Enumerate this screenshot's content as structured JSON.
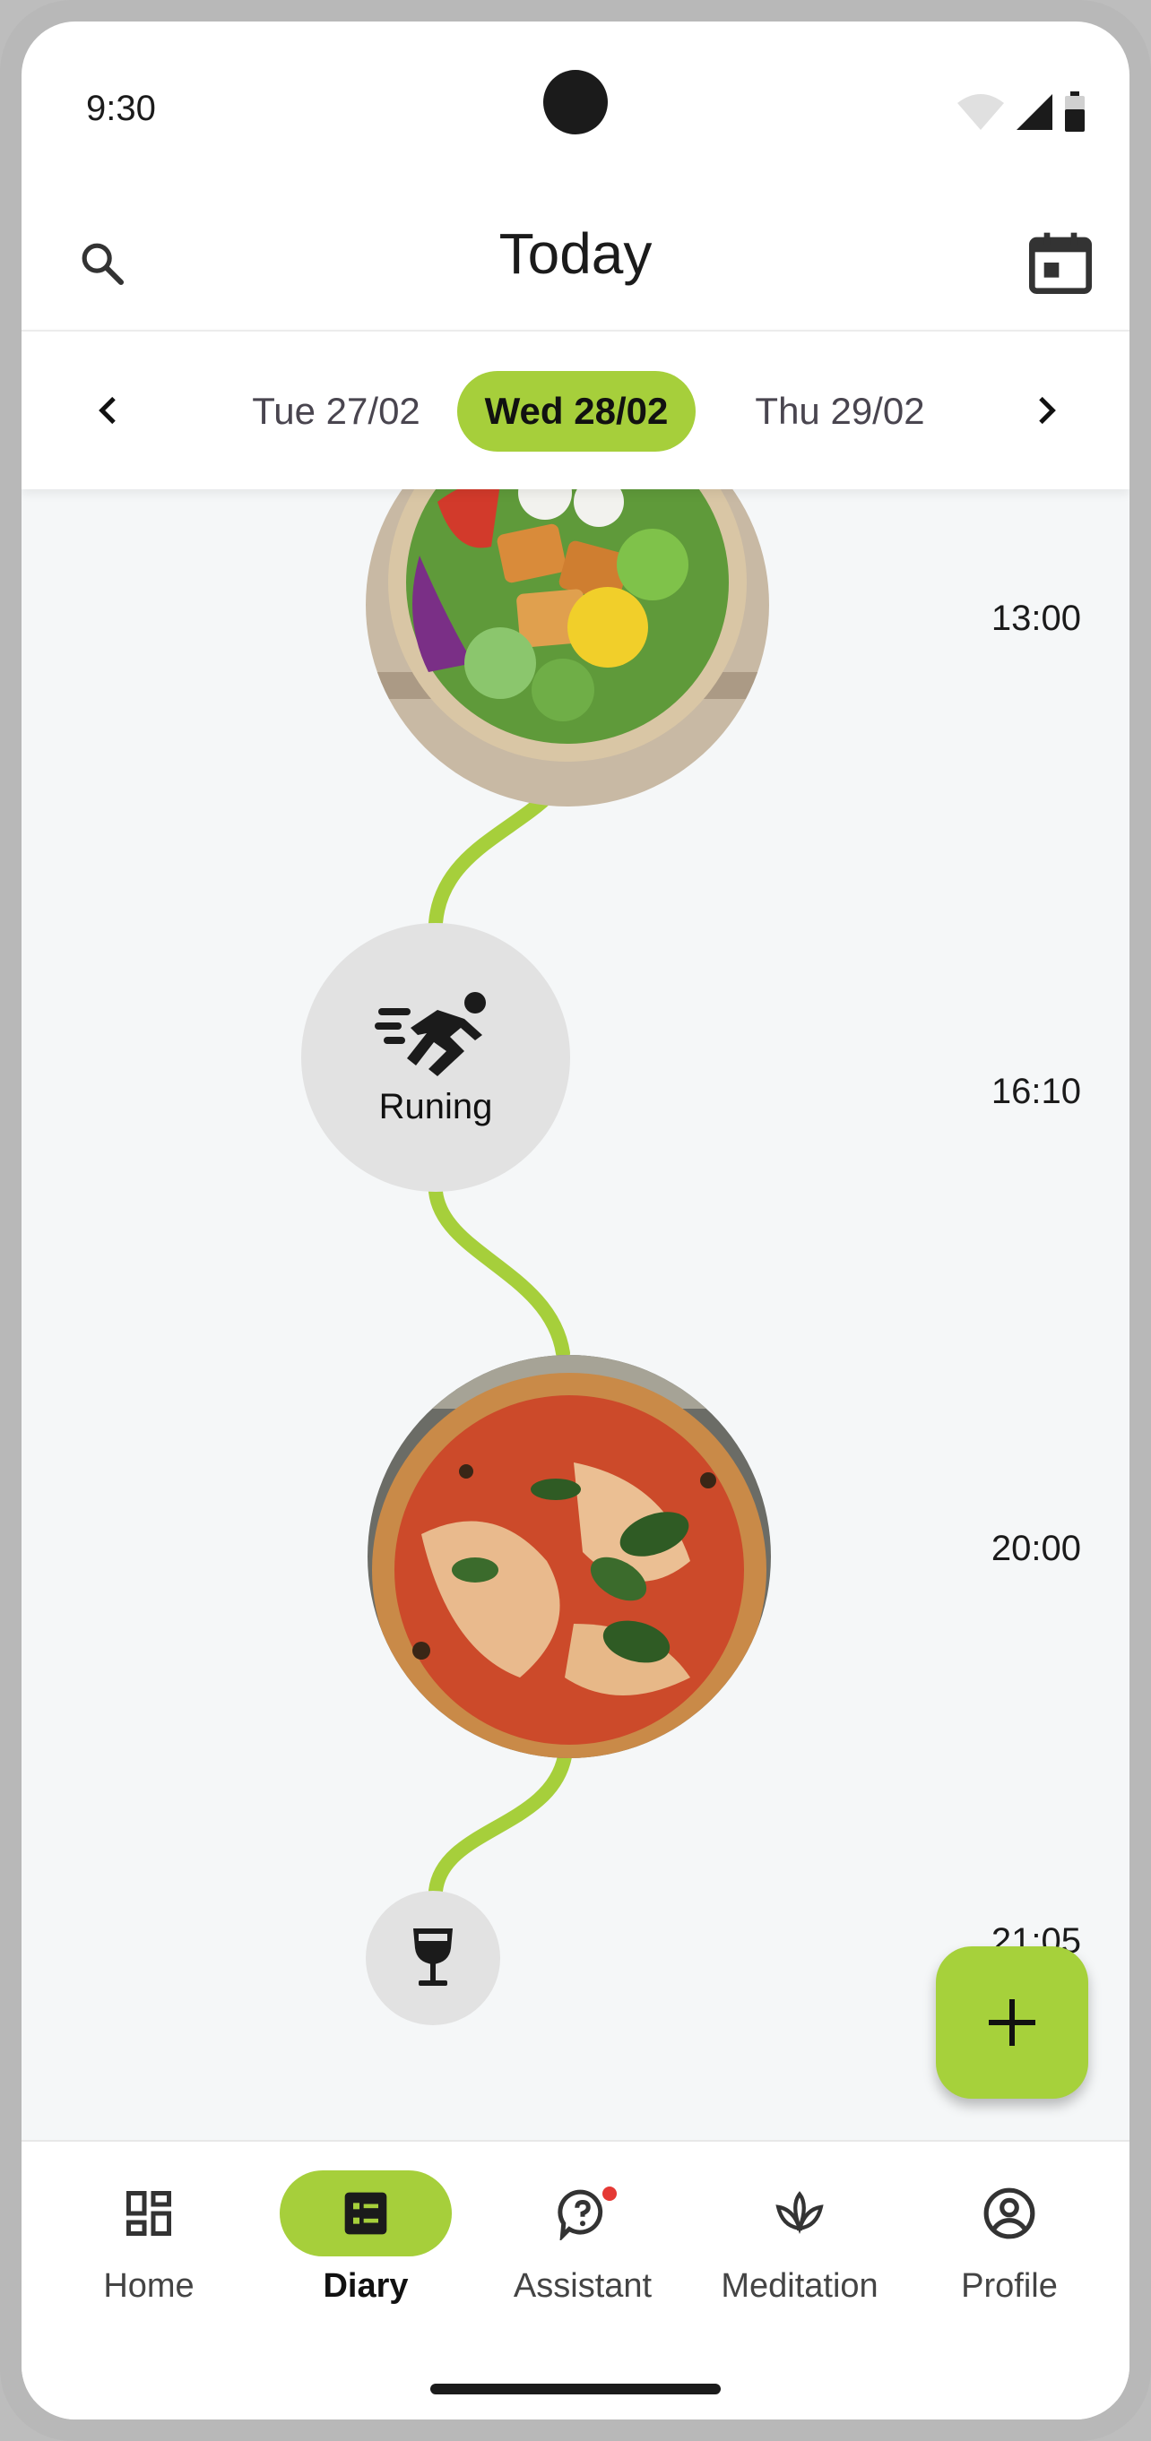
{
  "status_bar": {
    "time": "9:30"
  },
  "app_bar": {
    "title": "Today",
    "search_icon": "search-icon",
    "calendar_icon": "calendar-today-icon"
  },
  "date_selector": {
    "prev_icon": "chevron-left-icon",
    "next_icon": "chevron-right-icon",
    "dates": [
      {
        "label": "Tue 27/02",
        "selected": false
      },
      {
        "label": "Wed 28/02",
        "selected": true
      },
      {
        "label": "Thu 29/02",
        "selected": false
      }
    ]
  },
  "timeline": {
    "line_color": "#a6cf3b",
    "entries": [
      {
        "type": "meal-photo",
        "subject": "salad bowl",
        "time": "13:00"
      },
      {
        "type": "activity",
        "icon": "running-icon",
        "label": "Runing",
        "time": "16:10"
      },
      {
        "type": "meal-photo",
        "subject": "pizza",
        "time": "20:00"
      },
      {
        "type": "drink",
        "icon": "wine-glass-icon",
        "time": "21:05"
      }
    ]
  },
  "fab": {
    "icon": "plus-icon",
    "color": "#a6d13b"
  },
  "bottom_nav": {
    "active_color": "#a6cf3b",
    "items": [
      {
        "label": "Home",
        "icon": "dashboard-icon",
        "active": false
      },
      {
        "label": "Diary",
        "icon": "diary-list-icon",
        "active": true
      },
      {
        "label": "Assistant",
        "icon": "assistant-question-icon",
        "active": false,
        "badge": true
      },
      {
        "label": "Meditation",
        "icon": "lotus-icon",
        "active": false
      },
      {
        "label": "Profile",
        "icon": "account-circle-icon",
        "active": false
      }
    ]
  }
}
